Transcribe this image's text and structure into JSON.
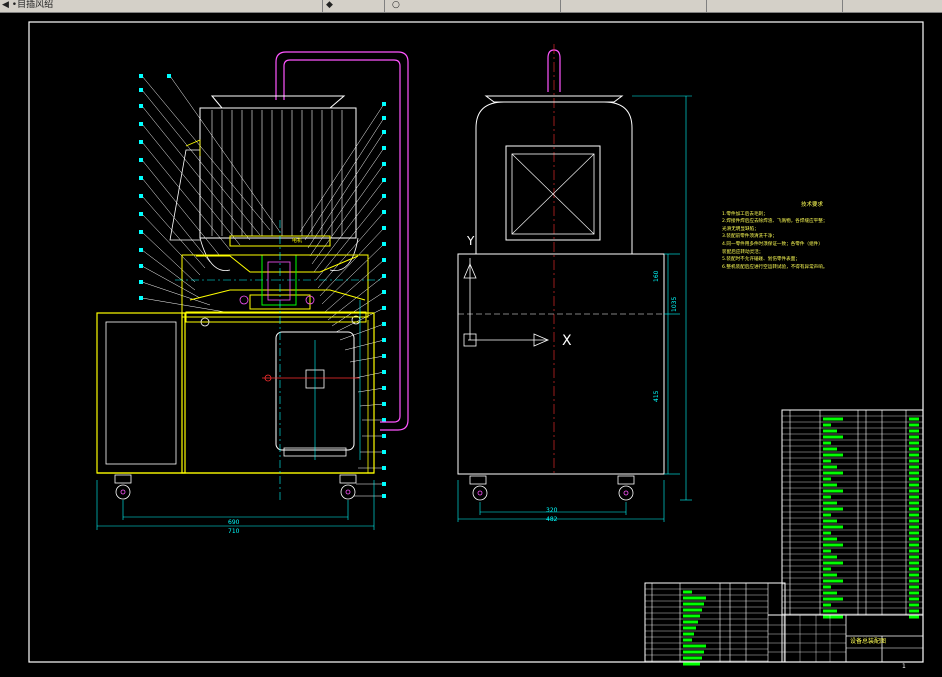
{
  "app_bar": {
    "item_1": "•目插风绍",
    "item_2": "",
    "item_3": "",
    "item_4": "",
    "item_5": "",
    "item_6": ""
  },
  "drawing": {
    "front_view": {
      "dim_overall_width": "710",
      "dim_inner_width": "690",
      "label_motor": "电机"
    },
    "side_view": {
      "axis_y": "Y",
      "axis_x": "X",
      "dim_width_outer": "482",
      "dim_width_inner": "320",
      "dim_height_total": "1035",
      "dim_height_upper": "160",
      "dim_height_lower": "415"
    },
    "technical_notes": {
      "title": "技术要求",
      "lines": [
        "1.零件加工后去毛刺；",
        "2.焊接件焊后应去除焊渣、飞溅物，各焊缝应平整；",
        "   光滑无明显缺陷；",
        "3.装配前零件须清洗干净；",
        "4.同一零件用多件时须保证一致；各零件（组件）",
        "   装配后应转动灵活；",
        "5.装配时不允许磕碰、划伤零件表面；",
        "6.整机装配后应进行空运转试验，不得有异常声响。"
      ]
    },
    "title_block": {
      "drawing_name": "设备总装配图",
      "sheet": "1"
    }
  },
  "colors": {
    "background": "#000000",
    "frame": "#ffffff",
    "yellow": "#ffff00",
    "cyan": "#00ffff",
    "magenta": "#ff55ff",
    "green": "#00ff00",
    "red": "#ff3030"
  }
}
